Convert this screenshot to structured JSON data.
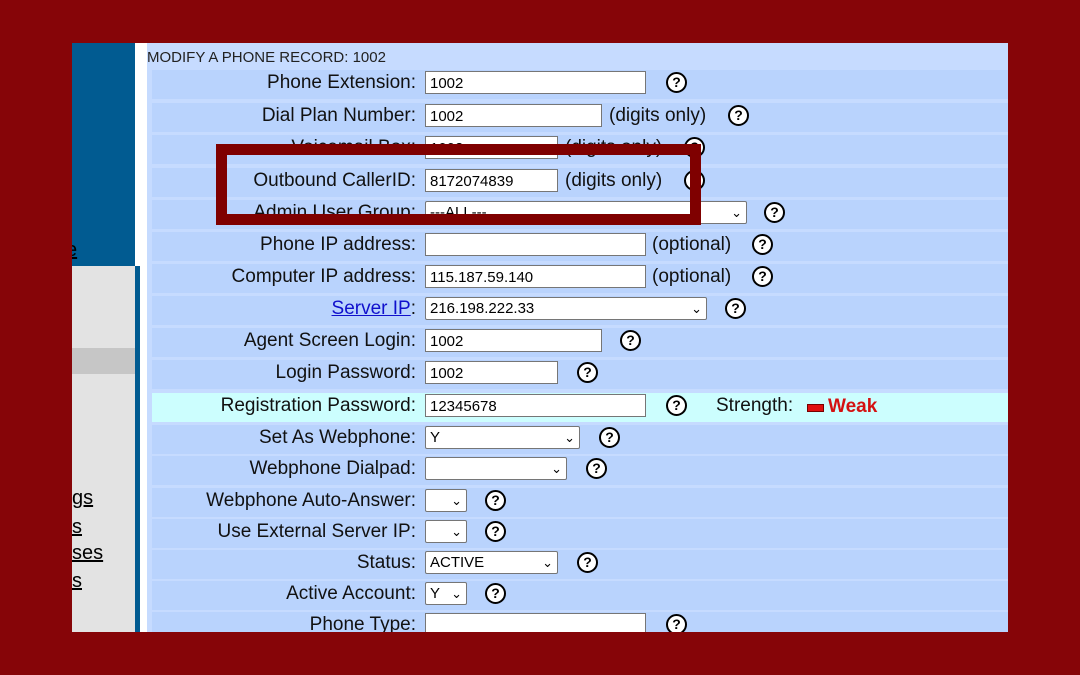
{
  "sidebar": {
    "links": [
      "gs",
      "s",
      "ses",
      "s"
    ]
  },
  "form": {
    "header": "MODIFY A PHONE RECORD: 1002",
    "rows": [
      {
        "label": "Phone Extension:",
        "value": "1002"
      },
      {
        "label": "Dial Plan Number:",
        "value": "1002",
        "hint": "(digits only)"
      },
      {
        "label": "Voicemail Box:",
        "value": "1002",
        "hint": "(digits only)"
      },
      {
        "label": "Outbound CallerID:",
        "value": "8172074839",
        "hint": "(digits only)"
      },
      {
        "label": "Admin User Group:",
        "value": "---ALL---"
      },
      {
        "label": "Phone IP address:",
        "value": "",
        "hint": "(optional)"
      },
      {
        "label": "Computer IP address:",
        "value": "115.187.59.140",
        "hint": "(optional)"
      },
      {
        "label": "Server IP",
        "colon": ":",
        "value": "216.198.222.33"
      },
      {
        "label": "Agent Screen Login:",
        "value": "1002"
      },
      {
        "label": "Login Password:",
        "value": "1002"
      },
      {
        "label": "Registration Password:",
        "value": "12345678",
        "strength_label": "Strength:",
        "strength_value": "Weak"
      },
      {
        "label": "Set As Webphone:",
        "value": "Y"
      },
      {
        "label": "Webphone Dialpad:",
        "value": ""
      },
      {
        "label": "Webphone Auto-Answer:",
        "value": ""
      },
      {
        "label": "Use External Server IP:",
        "value": ""
      },
      {
        "label": "Status:",
        "value": "ACTIVE"
      },
      {
        "label": "Active Account:",
        "value": "Y"
      },
      {
        "label": "Phone Type:",
        "value": ""
      }
    ],
    "help_glyph": "?",
    "dropdown_glyph": "⌄"
  },
  "colors": {
    "frame": "#860508",
    "highlight": "#7f0000",
    "row": "#b9d3fd",
    "row_alt": "#ccfefe",
    "weak": "#d41111"
  }
}
